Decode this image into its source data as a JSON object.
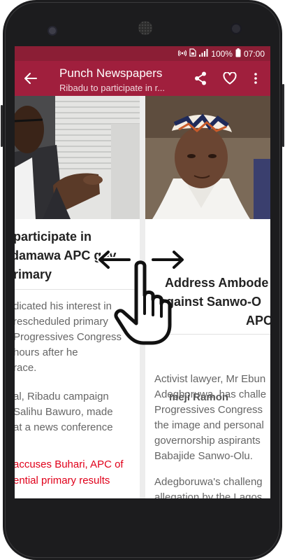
{
  "status_bar": {
    "battery": "100%",
    "time": "07:00",
    "icons": [
      "hotspot-icon",
      "sim-card-icon",
      "signal-icon",
      "battery-icon"
    ]
  },
  "toolbar": {
    "title": "Punch Newspapers",
    "subtitle": "Ribadu to participate in r...",
    "icons": [
      "back-arrow-icon",
      "share-icon",
      "heart-icon",
      "overflow-menu-icon"
    ]
  },
  "left_article": {
    "headline_lines": [
      "participate in",
      "damawa APC gov",
      "rimary"
    ],
    "body_lines": [
      "dicated his interest in",
      "rescheduled primary",
      "Progressives Congress",
      "hours after he",
      "race."
    ],
    "body2_lines": [
      "al, Ribadu campaign",
      "Salihu Bawuro, made",
      "at a news conference"
    ],
    "related_lines": [
      "accuses Buhari, APC of",
      "ential primary results"
    ]
  },
  "right_article": {
    "headline_lines": [
      "Address Ambode",
      "against Sanwo-O",
      "APC"
    ],
    "author": "Femi Ramon",
    "author_visible": "meji Ramon",
    "body_lines": [
      "Activist lawyer, Mr Ebun",
      "Adegboruwa, has challe",
      "Progressives Congress",
      "the image and personal",
      "governorship aspirants",
      "Babajide Sanwo-Olu."
    ],
    "body2_lines": [
      "Adegboruwa's challeng",
      "allegation by the Lagos",
      "Akinwunmi Ambode, th",
      "who seeks to unseat hi",
      "govern Lagos State bec"
    ]
  },
  "gesture": {
    "icons": [
      "left-arrow-icon",
      "right-arrow-icon",
      "pointing-hand-icon"
    ]
  },
  "colors": {
    "status_bar": "#8b1e35",
    "toolbar": "#a01f3d",
    "related_link": "#e0001a",
    "phone_body": "#1c1c1e"
  }
}
